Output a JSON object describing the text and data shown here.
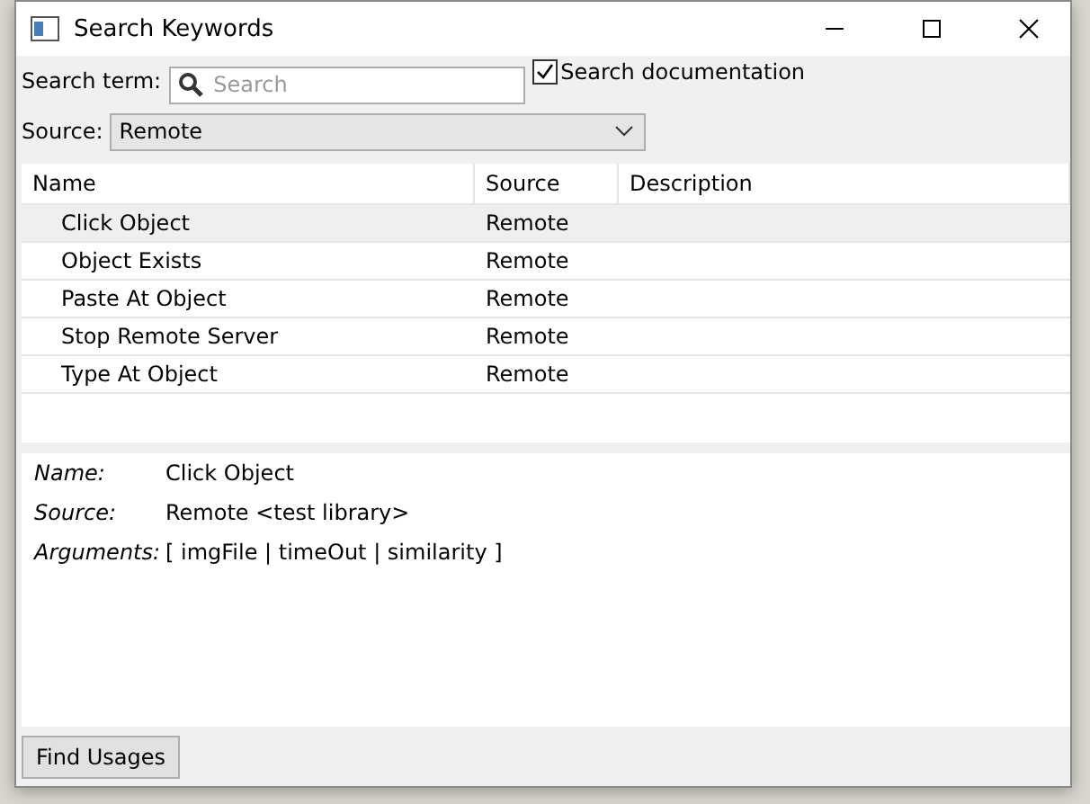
{
  "window": {
    "title": "Search Keywords"
  },
  "search": {
    "label": "Search term:",
    "placeholder": "Search"
  },
  "search_documentation": {
    "label": "Search documentation",
    "checked": true
  },
  "source": {
    "label": "Source:",
    "value": "Remote"
  },
  "table": {
    "columns": [
      "Name",
      "Source",
      "Description"
    ],
    "rows": [
      {
        "name": "Click Object",
        "source": "Remote",
        "selected": true
      },
      {
        "name": "Object Exists",
        "source": "Remote",
        "selected": false
      },
      {
        "name": "Paste At Object",
        "source": "Remote",
        "selected": false
      },
      {
        "name": "Stop Remote Server",
        "source": "Remote",
        "selected": false
      },
      {
        "name": "Type At Object",
        "source": "Remote",
        "selected": false
      }
    ]
  },
  "details": [
    {
      "label": "Name:",
      "value": "Click Object"
    },
    {
      "label": "Source:",
      "value": "Remote <test library>"
    },
    {
      "label": "Arguments:",
      "value": "[ imgFile | timeOut | similarity ]"
    }
  ],
  "buttons": [
    "Find Usages"
  ]
}
